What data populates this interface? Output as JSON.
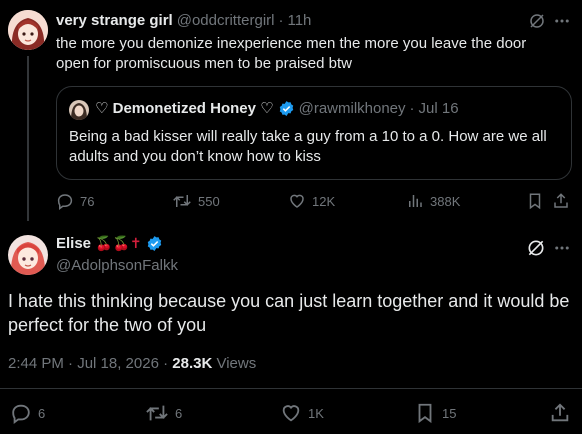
{
  "parent": {
    "display_name": "very strange girl",
    "handle": "@oddcrittergirl",
    "time": "11h",
    "separator": "·",
    "text": "the more you demonize inexperience men the more you leave the door open for promiscuous men to be praised btw",
    "quote": {
      "display_name": "♡ Demonetized Honey ♡",
      "handle": "@rawmilkhoney",
      "separator": "·",
      "date": "Jul 16",
      "text": "Being a bad kisser will really take a guy from a 10 to a 0. How are we all adults and you don’t know how to kiss"
    },
    "stats": {
      "replies": "76",
      "reposts": "550",
      "likes": "12K",
      "views": "388K"
    }
  },
  "reply": {
    "display_name": "Elise",
    "name_emoji": "🍒🍒✝",
    "handle": "@AdolphsonFalkk",
    "text": "I hate this thinking because you can just learn together and it would be perfect for the two of you",
    "timestamp": "2:44 PM · Jul 18, 2026 · ",
    "views_count": "28.3K",
    "views_label": " Views",
    "stats": {
      "replies": "6",
      "reposts": "6",
      "likes": "1K",
      "bookmarks": "15"
    }
  },
  "colors": {
    "background": "#000000",
    "text": "#e7e9ea",
    "muted": "#71767b",
    "verified": "#1d9bf0",
    "divider": "#2f3336"
  }
}
